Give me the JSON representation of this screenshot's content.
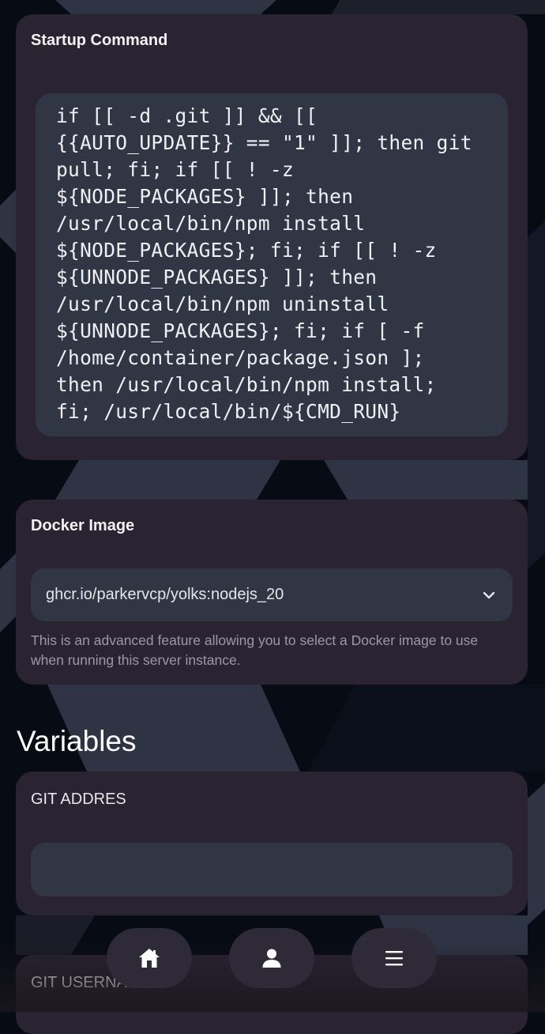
{
  "startup": {
    "title": "Startup Command",
    "command": "if [[ -d .git ]] && [[ {{AUTO_UPDATE}} == \"1\" ]]; then git pull; fi; if [[ ! -z ${NODE_PACKAGES} ]]; then /usr/local/bin/npm install ${NODE_PACKAGES}; fi; if [[ ! -z ${UNNODE_PACKAGES} ]]; then /usr/local/bin/npm uninstall ${UNNODE_PACKAGES}; fi; if [ -f /home/container/package.json ]; then /usr/local/bin/npm install; fi; /usr/local/bin/${CMD_RUN}",
    "command_lines": [
      "if [[ -d .git ]] && [[",
      "{{AUTO_UPDATE}} == \"1\" ]]; then git",
      "pull; fi; if [[ ! -z",
      "${NODE_PACKAGES} ]]; then",
      "/usr/local/bin/npm install",
      "${NODE_PACKAGES}; fi; if [[ ! -z",
      "${UNNODE_PACKAGES} ]]; then",
      "/usr/local/bin/npm uninstall",
      "${UNNODE_PACKAGES}; fi; if [ -f",
      "/home/container/package.json ];",
      "then /usr/local/bin/npm install;",
      "fi; /usr/local/bin/${CMD_RUN}"
    ]
  },
  "docker": {
    "title": "Docker Image",
    "selected": "ghcr.io/parkervcp/yolks:nodejs_20",
    "help": "This is an advanced feature allowing you to select a Docker image to use when running this server instance."
  },
  "variables": {
    "heading": "Variables",
    "items": [
      {
        "label": "GIT ADDRES",
        "value": ""
      },
      {
        "label": "GIT USERNAME",
        "value": ""
      }
    ]
  },
  "nav": {
    "items": [
      {
        "icon": "home-icon"
      },
      {
        "icon": "user-icon"
      },
      {
        "icon": "menu-icon"
      }
    ]
  },
  "colors": {
    "background": "#070b14",
    "card": "#2a2331",
    "field": "#313644",
    "nav_pill": "#2f2a37"
  }
}
